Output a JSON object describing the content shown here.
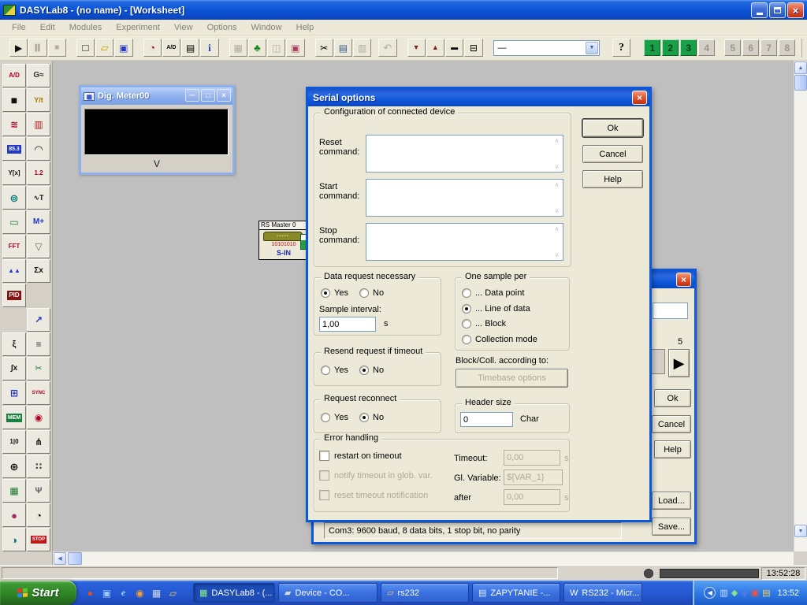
{
  "colors": {
    "titlebar_blue": "#0d53d7",
    "dialog_bg": "#ece9d8",
    "taskbar_blue": "#2456cf",
    "start_green": "#2e8225",
    "layer_active_green": "#18a048",
    "close_red": "#d8402c"
  },
  "window": {
    "title": "DASYLab8 - (no name) - [Worksheet]"
  },
  "menu": {
    "items": [
      "File",
      "Edit",
      "Modules",
      "Experiment",
      "View",
      "Options",
      "Window",
      "Help"
    ]
  },
  "toolbar": {
    "combo_value": "—",
    "layer_buttons": [
      {
        "label": "1",
        "active": true
      },
      {
        "label": "2",
        "active": true
      },
      {
        "label": "3",
        "active": true
      },
      {
        "label": "4",
        "active": false
      },
      {
        "label": "5",
        "active": false
      },
      {
        "label": "6",
        "active": false
      },
      {
        "label": "7",
        "active": false
      },
      {
        "label": "8",
        "active": false
      }
    ]
  },
  "icons": {
    "play": "▶",
    "pause": "▌▌",
    "stop": "■",
    "new": "□",
    "open": "▱",
    "save": "▣",
    "clock": "◔",
    "ad": "A/D",
    "layout": "▤",
    "info": "i",
    "worksheet": "▦",
    "tree": "♣",
    "split": "◫",
    "picture": "▣",
    "cut": "✂",
    "copy": "▤",
    "paste": "▥",
    "undo": "↶",
    "arrow_down": "▼",
    "arrow_up": "▲",
    "min_module": "▬",
    "panel": "⊟",
    "combo_arrow": "▼",
    "help": "?",
    "win_min": "—",
    "win_restore": "▣",
    "win_close": "×",
    "scroll_up": "∧",
    "scroll_down": "∨",
    "sb_up": "▲",
    "sb_down": "▼",
    "sb_left": "◀",
    "flag_arrow": "▶",
    "tray_chevron": "◀"
  },
  "sidebar": {
    "icons": [
      {
        "name": "ad-converter",
        "label": "A/D",
        "fg": "#b00020",
        "bg": "",
        "size": 8
      },
      {
        "name": "signal-generator",
        "label": "G≈",
        "fg": "#303030",
        "bg": "",
        "size": 10
      },
      {
        "name": "blackbox",
        "label": "■",
        "fg": "#101010",
        "bg": "",
        "size": 14
      },
      {
        "name": "yt-chart",
        "label": "Y/t",
        "fg": "#a07800",
        "bg": "",
        "size": 9
      },
      {
        "name": "switch-module",
        "label": "≋",
        "fg": "#b00020",
        "bg": "",
        "size": 12
      },
      {
        "name": "slider-module",
        "label": "▥",
        "fg": "#b02020",
        "bg": "",
        "size": 12
      },
      {
        "name": "digital-meter",
        "label": "85.3",
        "fg": "#ffffff",
        "bg": "#2238c8",
        "size": 7
      },
      {
        "name": "analog-meter",
        "label": "◠",
        "fg": "#101010",
        "bg": "",
        "size": 13
      },
      {
        "name": "xy-chart",
        "label": "Y[x]",
        "fg": "#101010",
        "bg": "",
        "size": 8
      },
      {
        "name": "list-display",
        "label": "1.2",
        "fg": "#b00020",
        "bg": "",
        "size": 8
      },
      {
        "name": "lamp-module",
        "label": "⊚",
        "fg": "#007878",
        "bg": "",
        "size": 13
      },
      {
        "name": "trigger-module",
        "label": "∿T",
        "fg": "#101010",
        "bg": "",
        "size": 9
      },
      {
        "name": "relay-module",
        "label": "▭",
        "fg": "#1a7a30",
        "bg": "",
        "size": 12
      },
      {
        "name": "math-module",
        "label": "M+",
        "fg": "#2238c8",
        "bg": "",
        "size": 10
      },
      {
        "name": "fft-module",
        "label": "FFT",
        "fg": "#b00020",
        "bg": "",
        "size": 8
      },
      {
        "name": "filter-module",
        "label": "▽",
        "fg": "#5a6a5a",
        "bg": "",
        "size": 12
      },
      {
        "name": "signal-shaper",
        "label": "▲▲",
        "fg": "#2238c8",
        "bg": "",
        "size": 8
      },
      {
        "name": "statistics-module",
        "label": "Σx",
        "fg": "#101010",
        "bg": "",
        "size": 10
      },
      {
        "name": "pid-module",
        "label": "PID",
        "fg": "#ffffff",
        "bg": "#8b1010",
        "size": 8
      },
      {
        "name": "empty-slot",
        "label": "",
        "fg": "",
        "bg": "",
        "size": 8
      },
      {
        "name": "empty-slot",
        "label": "",
        "fg": "",
        "bg": "",
        "size": 8
      },
      {
        "name": "regression-module",
        "label": "↗",
        "fg": "#2238c8",
        "bg": "",
        "size": 12
      },
      {
        "name": "event-module",
        "label": "ξ",
        "fg": "#101010",
        "bg": "",
        "size": 11
      },
      {
        "name": "multi-slider",
        "label": "≡",
        "fg": "#404040",
        "bg": "",
        "size": 12
      },
      {
        "name": "integration-module",
        "label": "∫x",
        "fg": "#101010",
        "bg": "",
        "size": 10
      },
      {
        "name": "cutout-module",
        "label": "✂",
        "fg": "#1a7a30",
        "bg": "",
        "size": 11
      },
      {
        "name": "counter-module",
        "label": "⊞",
        "fg": "#2238c8",
        "bg": "",
        "size": 12
      },
      {
        "name": "sync-module",
        "label": "SYNC",
        "fg": "#b00020",
        "bg": "",
        "size": 6
      },
      {
        "name": "memory-module",
        "label": "MEM",
        "fg": "#ffffff",
        "bg": "#1a8040",
        "size": 7
      },
      {
        "name": "disc-module",
        "label": "◉",
        "fg": "#b00020",
        "bg": "",
        "size": 12
      },
      {
        "name": "digital-module",
        "label": "1|0",
        "fg": "#101010",
        "bg": "",
        "size": 8
      },
      {
        "name": "demux-module",
        "label": "⋔",
        "fg": "#101010",
        "bg": "",
        "size": 12
      },
      {
        "name": "polar-plot",
        "label": "⊕",
        "fg": "#101010",
        "bg": "",
        "size": 13
      },
      {
        "name": "scatter-plot",
        "label": "∷",
        "fg": "#404040",
        "bg": "",
        "size": 12
      },
      {
        "name": "shift-register",
        "label": "▦",
        "fg": "#1a7a30",
        "bg": "",
        "size": 12
      },
      {
        "name": "charge-module",
        "label": "Ψ",
        "fg": "#606060",
        "bg": "",
        "size": 11
      },
      {
        "name": "pie-chart-module",
        "label": "●",
        "fg": "#a03060",
        "bg": "",
        "size": 13
      },
      {
        "name": "stopwatch-module",
        "label": "◔",
        "fg": "#101010",
        "bg": "",
        "size": 13
      },
      {
        "name": "clock-module",
        "label": "◑",
        "fg": "#007878",
        "bg": "",
        "size": 13
      },
      {
        "name": "stop-module",
        "label": "STOP",
        "fg": "#ffffff",
        "bg": "#c01818",
        "size": 6
      }
    ]
  },
  "worksheet": {
    "meter_window": {
      "title": "Dig. Meter00",
      "unit": "V"
    },
    "rs_module": {
      "title": "RS Master 0",
      "bits": "10101010",
      "port": "S-IN"
    }
  },
  "serial_dialog": {
    "title": "Serial options",
    "config_group": "Configuration of connected device",
    "reset_label": "Reset command:",
    "start_label": "Start command:",
    "stop_label": "Stop command:",
    "ok": "Ok",
    "cancel": "Cancel",
    "help": "Help",
    "data_request": {
      "title": "Data request necessary",
      "yes": "Yes",
      "no": "No",
      "selected": "Yes",
      "interval_label": "Sample interval:",
      "interval_value": "1,00",
      "unit": "s"
    },
    "one_sample": {
      "title": "One sample per",
      "selected": 1,
      "options": [
        "... Data point",
        "... Line of data",
        "... Block",
        "Collection mode"
      ]
    },
    "block_coll_label": "Block/Coll. according to:",
    "timebase_button": "Timebase options",
    "resend": {
      "title": "Resend request if timeout",
      "yes": "Yes",
      "no": "No",
      "selected": "No"
    },
    "reconnect": {
      "title": "Request reconnect",
      "yes": "Yes",
      "no": "No",
      "selected": "No"
    },
    "header_size": {
      "title": "Header size",
      "value": "0",
      "unit": "Char"
    },
    "error_handling": {
      "title": "Error handling",
      "checkboxes": [
        {
          "label": "restart on timeout",
          "enabled": true,
          "checked": false
        },
        {
          "label": "notify timeout in glob. var.",
          "enabled": false,
          "checked": false
        },
        {
          "label": "reset timeout notification",
          "enabled": false,
          "checked": false
        }
      ],
      "timeout_label": "Timeout:",
      "timeout_value": "0,00",
      "timeout_unit": "s",
      "variable_label": "Gl. Variable:",
      "variable_value": "${VAR_1}",
      "after_label": "after",
      "after_value": "0,00",
      "after_unit": "s"
    }
  },
  "device_dialog": {
    "value": "5",
    "ok": "Ok",
    "cancel": "Cancel",
    "help": "Help",
    "load": "Load...",
    "save": "Save...",
    "status": "Com3: 9600 baud, 8 data bits, 1 stop bit, no parity"
  },
  "statusbar": {
    "time": "13:52:28"
  },
  "taskbar": {
    "start": "Start",
    "quick_launch": [
      "launcher-icon",
      "windows-app-icon",
      "internet-explorer-icon",
      "media-player-icon",
      "calculator-icon",
      "folder-icon"
    ],
    "tasks": [
      {
        "label": "DASYLab8 - (...",
        "icon": "dasylab",
        "active": true
      },
      {
        "label": "Device - CO...",
        "icon": "device",
        "active": false
      },
      {
        "label": "rs232",
        "icon": "folder",
        "active": false
      },
      {
        "label": "ZAPYTANIE -...",
        "icon": "notepad",
        "active": false
      },
      {
        "label": "RS232 - Micr...",
        "icon": "word",
        "active": false
      }
    ],
    "tray_icons": [
      "network-icon",
      "removal-icon",
      "antivirus-icon",
      "connection-icon",
      "display-icon"
    ],
    "clock": "13:52"
  }
}
